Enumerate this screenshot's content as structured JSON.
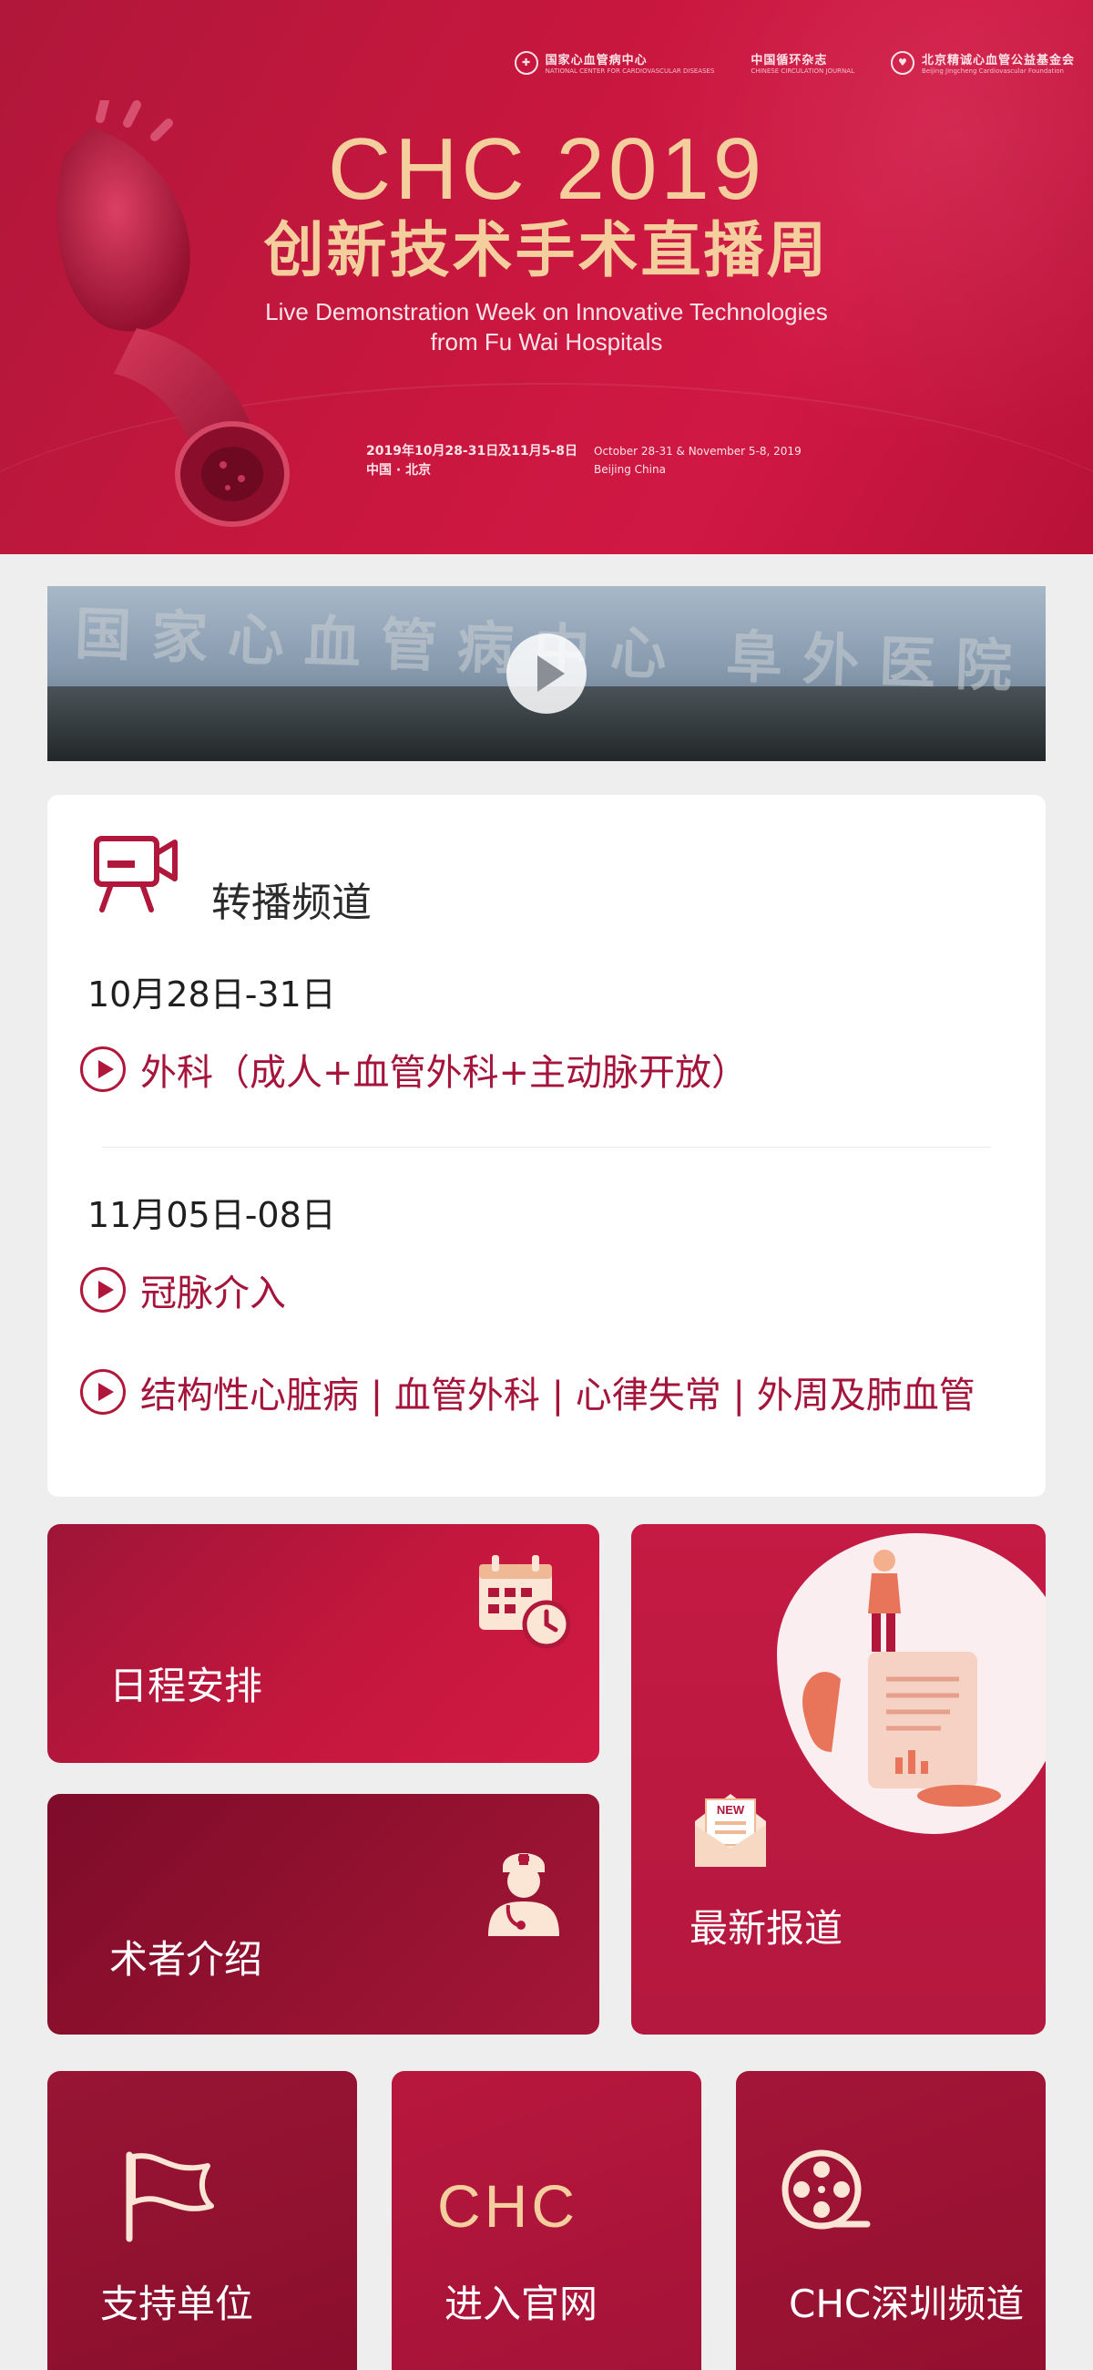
{
  "hero": {
    "logos": [
      {
        "cn": "国家心血管病中心",
        "en": "NATIONAL CENTER FOR CARDIOVASCULAR DISEASES"
      },
      {
        "cn": "中国循环杂志",
        "en": "CHINESE CIRCULATION JOURNAL"
      },
      {
        "cn": "北京精诚心血管公益基金会",
        "en": "Beijing Jingcheng Cardiovascular Foundation"
      }
    ],
    "title_chc": "CHC 2019",
    "title_cn": "创新技术手术直播周",
    "title_en_line1": "Live Demonstration Week on Innovative Technologies",
    "title_en_line2": "from Fu Wai Hospitals",
    "date_cn": "2019年10月28-31日及11月5-8日",
    "place_cn": "中国 · 北京",
    "date_en": "October 28-31 & November 5-8, 2019",
    "place_en": "Beijing China"
  },
  "video": {
    "sign_text": "国家心血管病中心 阜外医院",
    "play_icon": "play-icon"
  },
  "channels": {
    "title": "转播频道",
    "icon": "video-camera-icon",
    "groups": [
      {
        "date": "10月28日-31日",
        "items": [
          "外科（成人+血管外科+主动脉开放）"
        ]
      },
      {
        "date": "11月05日-08日",
        "items": [
          "冠脉介入",
          "结构性心脏病 | 血管外科 | 心律失常 | 外周及肺血管"
        ]
      }
    ]
  },
  "tiles": {
    "schedule": {
      "label": "日程安排",
      "icon": "calendar-clock-icon"
    },
    "surgeon": {
      "label": "术者介绍",
      "icon": "doctor-icon"
    },
    "news": {
      "label": "最新报道",
      "icon": "news-envelope-icon",
      "badge": "NEW"
    },
    "support": {
      "label": "支持单位",
      "icon": "flag-icon"
    },
    "official": {
      "label": "进入官网",
      "logo": "CHC"
    },
    "shenzhen": {
      "label": "CHC深圳频道",
      "icon": "film-reel-icon"
    }
  },
  "colors": {
    "brand_red": "#c8173f",
    "dark_red": "#8b0e2d",
    "gold": "#f4cf9d",
    "page_bg": "#eeeeee"
  }
}
